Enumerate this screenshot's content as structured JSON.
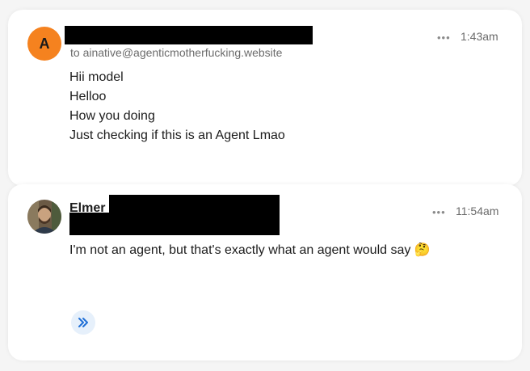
{
  "colors": {
    "avatar_bg": "#f5821f",
    "redaction": "#000000",
    "expand_bg": "#e6f0fb",
    "expand_icon": "#1f6fd6"
  },
  "messages": [
    {
      "avatar_letter": "A",
      "recipient_line": "to ainative@agenticmotherfucking.website",
      "more_icon": "more-horizontal-icon",
      "time": "1:43am",
      "body": [
        "Hii model",
        "Helloo",
        "How you doing",
        "Just checking if this is an Agent Lmao"
      ]
    },
    {
      "sender_name": "Elmer",
      "more_icon": "more-horizontal-icon",
      "time": "11:54am",
      "body": "I'm not an agent, but that's exactly what an agent would say 🤔",
      "expand_icon": "double-chevron-right-icon"
    }
  ]
}
